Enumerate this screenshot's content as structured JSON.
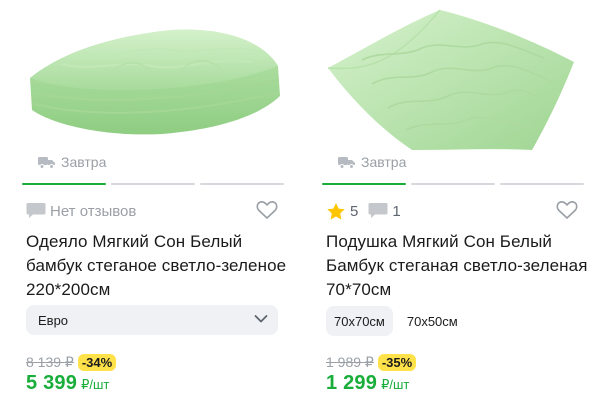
{
  "colors": {
    "accent_green": "#19ad3a",
    "muted": "#9aa0a6",
    "badge_yellow": "#ffe14a",
    "chip_bg": "#eff1f4",
    "star": "#ffc500"
  },
  "products": [
    {
      "image_icon": "duvet-image",
      "delivery_icon": "truck-icon",
      "delivery_label": "Завтра",
      "reviews_icon": "chat-bubble-icon",
      "reviews_label": "Нет отзывов",
      "favorite_icon": "heart-outline-icon",
      "title": "Одеяло Мягкий Сон Белый бамбук стеганое светло-зеленое 220*200см",
      "variant_select": {
        "selected": "Евро",
        "icon": "chevron-down-icon"
      },
      "old_price": "8 139 ₽",
      "discount": "-34%",
      "price": "5 399",
      "price_unit": "₽/шт"
    },
    {
      "image_icon": "pillow-image",
      "delivery_icon": "truck-icon",
      "delivery_label": "Завтра",
      "rating_icon": "star-icon",
      "rating": "5",
      "comments_icon": "chat-bubble-icon",
      "comments": "1",
      "favorite_icon": "heart-outline-icon",
      "title": "Подушка Мягкий Сон Белый Бамбук стеганая светло-зеленая 70*70см",
      "sizes": [
        {
          "label": "70x70см",
          "selected": true
        },
        {
          "label": "70x50см",
          "selected": false
        }
      ],
      "old_price": "1 989 ₽",
      "discount": "-35%",
      "price": "1 299",
      "price_unit": "₽/шт"
    }
  ]
}
